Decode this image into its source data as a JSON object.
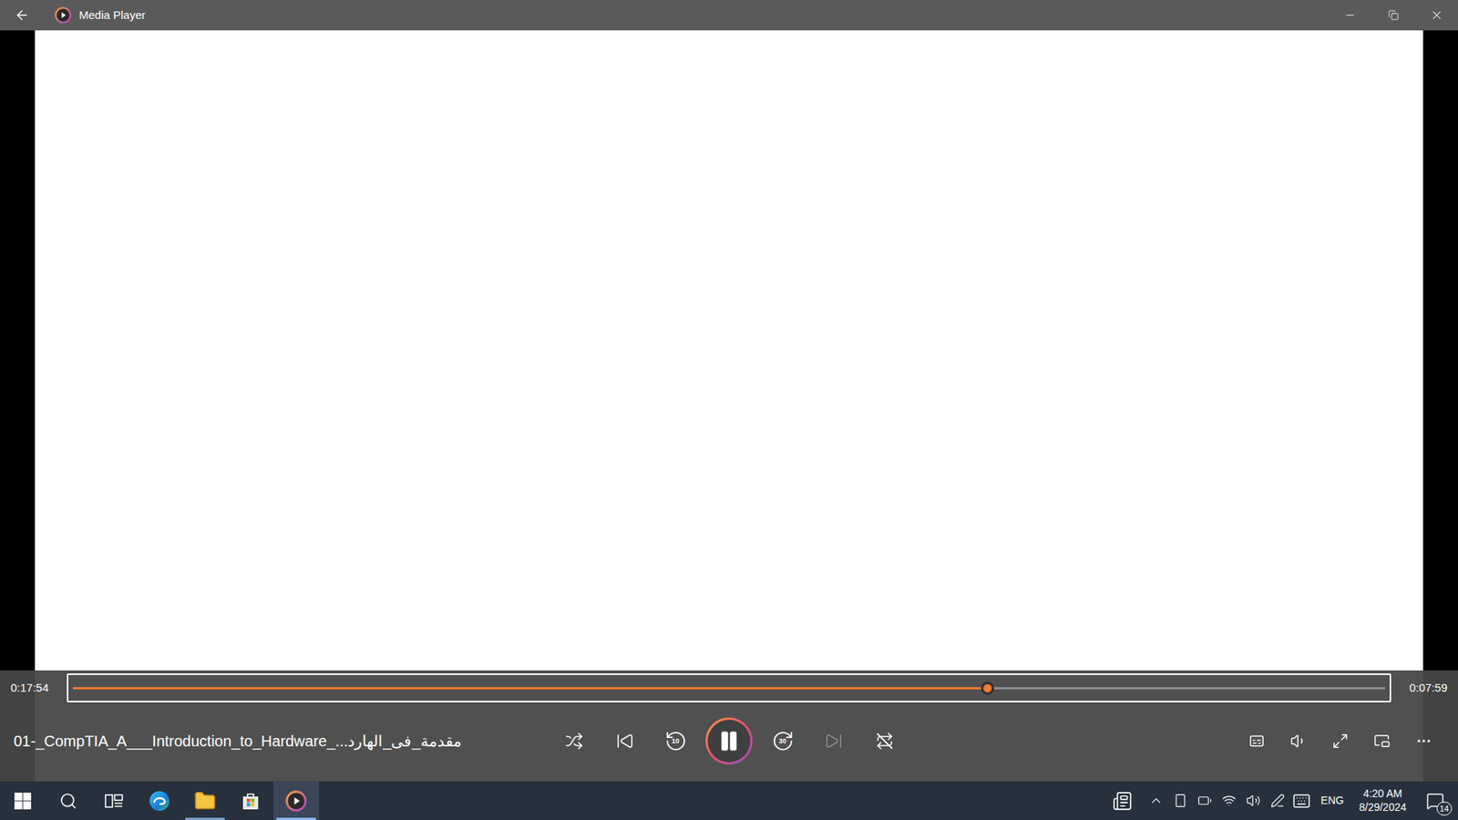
{
  "window": {
    "title": "Media Player"
  },
  "player": {
    "playing": true
  },
  "progress": {
    "elapsed": "0:17:54",
    "remaining": "0:07:59",
    "level": 0.697
  },
  "now_playing": {
    "title": "01-_CompTIA_A___Introduction_to_Hardware_...مقدمة_فى_الهارد"
  },
  "transport": [
    {
      "kind": "shuffle",
      "label": "",
      "on": false,
      "disabled": false
    },
    {
      "kind": "previous",
      "label": "",
      "on": false,
      "disabled": false
    },
    {
      "kind": "rewind",
      "label": "10",
      "on": false,
      "disabled": false
    },
    {
      "kind": "play-pause",
      "label": "",
      "on": false,
      "disabled": false
    },
    {
      "kind": "forward",
      "label": "30",
      "on": false,
      "disabled": false
    },
    {
      "kind": "next",
      "label": "",
      "on": false,
      "disabled": true
    },
    {
      "kind": "repeat",
      "label": "",
      "on": false,
      "disabled": false
    }
  ],
  "view_controls": [
    {
      "kind": "captions"
    },
    {
      "kind": "volume"
    },
    {
      "kind": "fullscreen"
    },
    {
      "kind": "mini-view"
    },
    {
      "kind": "more"
    }
  ],
  "taskbar": {
    "apps": [
      {
        "kind": "start",
        "open": false,
        "active": false
      },
      {
        "kind": "search",
        "open": false,
        "active": false
      },
      {
        "kind": "task-view",
        "open": false,
        "active": false
      },
      {
        "kind": "edge",
        "open": false,
        "active": false
      },
      {
        "kind": "file-explorer",
        "open": true,
        "active": false
      },
      {
        "kind": "store",
        "open": false,
        "active": false
      },
      {
        "kind": "media-player",
        "open": true,
        "active": true
      }
    ],
    "tray": [
      {
        "kind": "news"
      },
      {
        "kind": "chevron"
      },
      {
        "kind": "phone"
      },
      {
        "kind": "battery"
      },
      {
        "kind": "wifi"
      },
      {
        "kind": "volume"
      },
      {
        "kind": "pen"
      },
      {
        "kind": "keyboard"
      }
    ],
    "language": "ENG",
    "time": "4:20 AM",
    "date": "8/29/2024",
    "notifications": "14"
  }
}
